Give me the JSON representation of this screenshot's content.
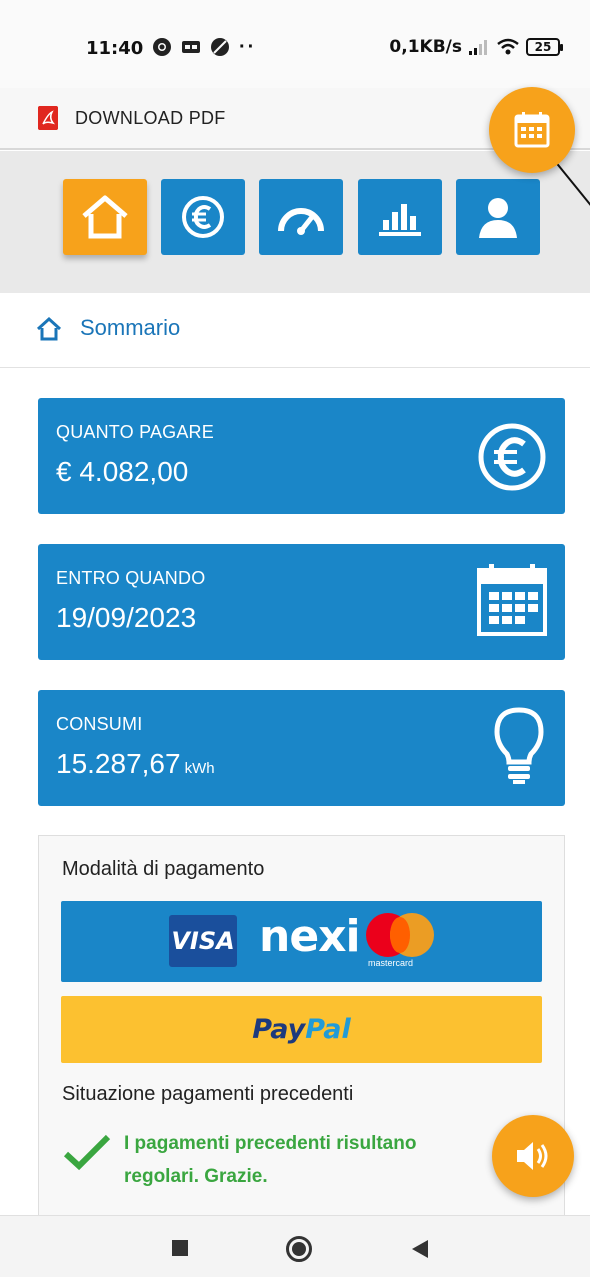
{
  "status_bar": {
    "time": "11:40",
    "dots": "··",
    "network_speed": "0,1KB/s",
    "battery": "25"
  },
  "pdf_bar": {
    "label": "DOWNLOAD PDF"
  },
  "nav": {
    "items": [
      {
        "icon": "home-icon",
        "active": true
      },
      {
        "icon": "euro-icon",
        "active": false
      },
      {
        "icon": "gauge-icon",
        "active": false
      },
      {
        "icon": "bar-chart-icon",
        "active": false
      },
      {
        "icon": "user-icon",
        "active": false
      }
    ]
  },
  "section": {
    "title": "Sommario"
  },
  "cards": [
    {
      "label": "QUANTO PAGARE",
      "value": "€ 4.082,00",
      "unit": "",
      "icon": "euro-icon"
    },
    {
      "label": "ENTRO QUANDO",
      "value": "19/09/2023",
      "unit": "",
      "icon": "calendar-icon"
    },
    {
      "label": "CONSUMI",
      "value": "15.287,67",
      "unit": "kWh",
      "icon": "lightbulb-icon"
    }
  ],
  "payment": {
    "title": "Modalità di pagamento",
    "card_brands": {
      "visa": "VISA",
      "nexi": "nexi",
      "mastercard": "mastercard"
    },
    "paypal": {
      "part1": "Pay",
      "part2": "Pal"
    },
    "previous_title": "Situazione pagamenti precedenti",
    "previous_message": "I pagamenti precedenti risultano regolari. Grazie."
  },
  "colors": {
    "primary_blue": "#1a86c8",
    "accent_orange": "#f7a21b",
    "success_green": "#3aa640",
    "paypal_yellow": "#fcc130"
  }
}
